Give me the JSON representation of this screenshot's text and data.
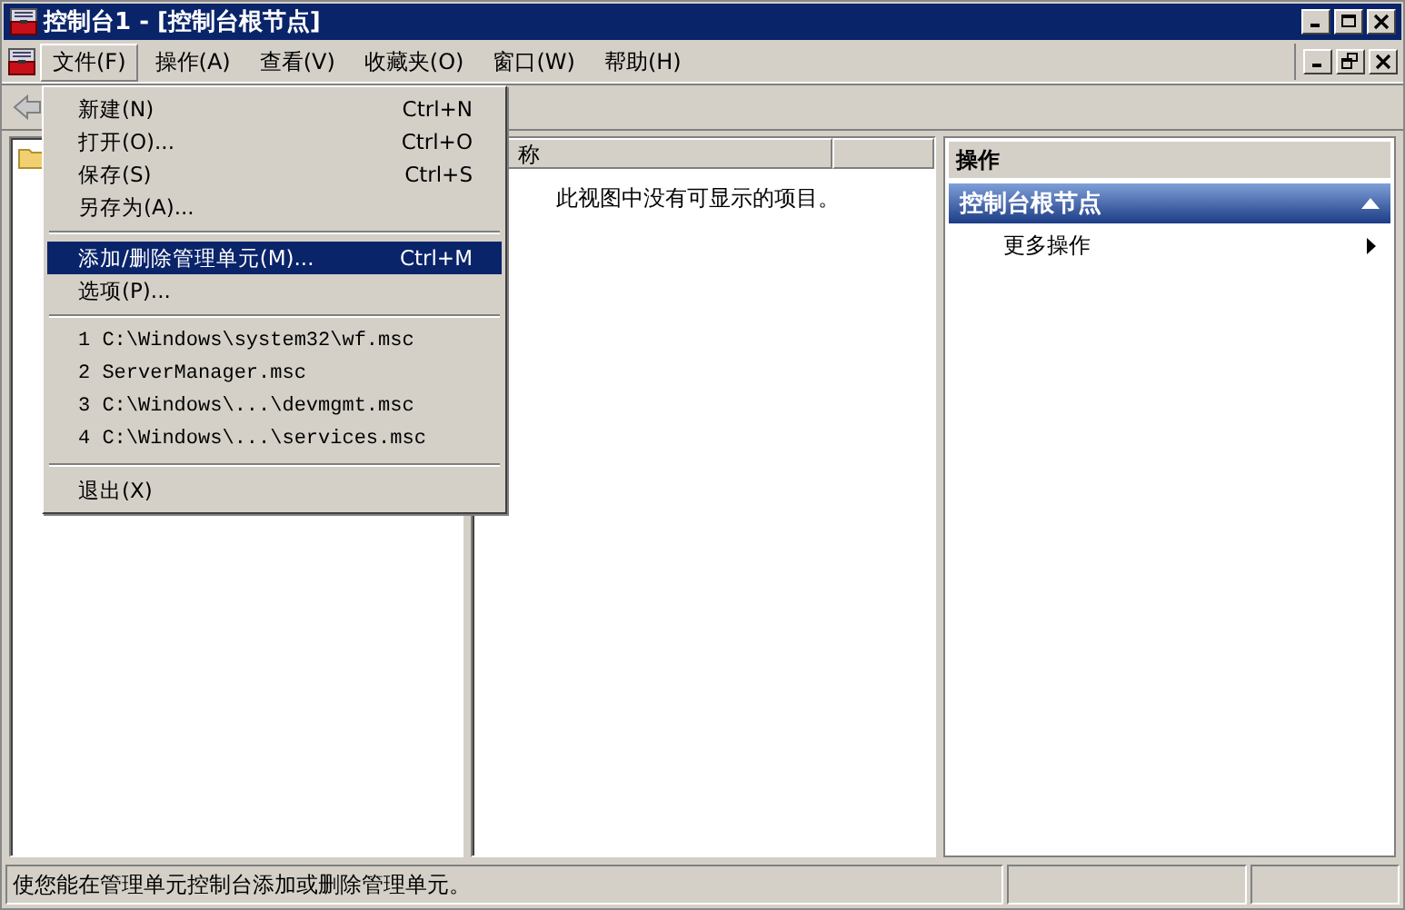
{
  "window": {
    "title": "控制台1 - [控制台根节点]"
  },
  "menu_bar": [
    {
      "label": "文件(F)",
      "selected": true
    },
    {
      "label": "操作(A)",
      "selected": false
    },
    {
      "label": "查看(V)",
      "selected": false
    },
    {
      "label": "收藏夹(O)",
      "selected": false
    },
    {
      "label": "窗口(W)",
      "selected": false
    },
    {
      "label": "帮助(H)",
      "selected": false
    }
  ],
  "file_menu": [
    {
      "kind": "item",
      "label": "新建(N)",
      "shortcut": "Ctrl+N",
      "selected": false
    },
    {
      "kind": "item",
      "label": "打开(O)...",
      "shortcut": "Ctrl+O",
      "selected": false
    },
    {
      "kind": "item",
      "label": "保存(S)",
      "shortcut": "Ctrl+S",
      "selected": false
    },
    {
      "kind": "item",
      "label": "另存为(A)...",
      "selected": false
    },
    {
      "kind": "separator"
    },
    {
      "kind": "item",
      "label": "添加/删除管理单元(M)...",
      "shortcut": "Ctrl+M",
      "selected": true
    },
    {
      "kind": "item",
      "label": "选项(P)...",
      "selected": false
    },
    {
      "kind": "separator"
    },
    {
      "kind": "recent",
      "label": "1 C:\\Windows\\system32\\wf.msc",
      "selected": false
    },
    {
      "kind": "recent",
      "label": "2 ServerManager.msc",
      "selected": false
    },
    {
      "kind": "recent",
      "label": "3 C:\\Windows\\...\\devmgmt.msc",
      "selected": false
    },
    {
      "kind": "recent",
      "label": "4 C:\\Windows\\...\\services.msc",
      "selected": false
    },
    {
      "kind": "separator"
    },
    {
      "kind": "item",
      "label": "退出(X)",
      "selected": false
    }
  ],
  "results_pane": {
    "columns": [
      "称",
      ""
    ],
    "empty_message": "此视图中没有可显示的项目。"
  },
  "actions_pane": {
    "title": "操作",
    "section": {
      "title": "控制台根节点",
      "expanded": true
    },
    "items": [
      {
        "label": "更多操作"
      }
    ]
  },
  "status_bar": {
    "text": "使您能在管理单元控制台添加或删除管理单元。"
  }
}
